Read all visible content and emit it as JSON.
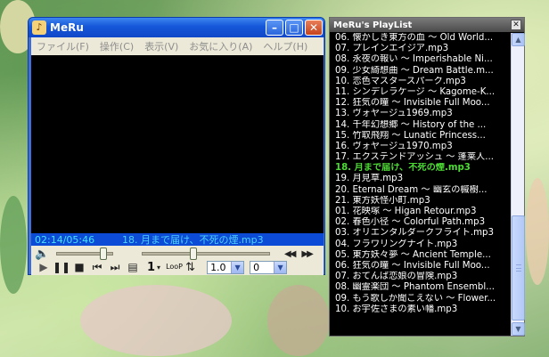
{
  "player": {
    "title": "MeRu",
    "app_icon": "♪",
    "window_buttons": {
      "minimize": "–",
      "maximize": "□",
      "close": "✕"
    },
    "menu": [
      "ファイル(F)",
      "操作(C)",
      "表示(V)",
      "お気に入り(A)",
      "ヘルプ(H)"
    ],
    "status": {
      "time": "02:14/05:46",
      "now_playing": "18. 月まで届け、不死の煙.mp3"
    },
    "controls": {
      "speaker_icon": "🔈",
      "volume_level": 0.85,
      "seek_position": 0.39,
      "prev_glyph": "◀◀",
      "next_glyph": "▶▶",
      "play": "▶",
      "pause": "❚❚",
      "stop": "■",
      "prev_track": "⏮",
      "next_track": "⏭",
      "playlist_icon": "▤",
      "repeat_value": "1",
      "dropdown_glyph": "▾",
      "loop_label": "LooP",
      "shuffle_icon": "⇅",
      "speed_value": "1.0",
      "pitch_value": "0",
      "select_arrow": "▼"
    }
  },
  "playlist": {
    "title": "MeRu's PlayList",
    "close": "✕",
    "items": [
      "06. 懐かしき東方の血 ～ Old World...",
      "07. プレインエイジア.mp3",
      "08. 永夜の報い ～ Imperishable Ni...",
      "09. 少女綺想曲 ～ Dream Battle.m...",
      "10. 恋色マスタースパーク.mp3",
      "11. シンデレラケージ ～ Kagome-K...",
      "12. 狂気の瞳 ～ Invisible Full Moo...",
      "13. ヴォヤージュ1969.mp3",
      "14. 千年幻想郷 ～ History of the ...",
      "15. 竹取飛翔 ～ Lunatic Princess...",
      "16. ヴォヤージュ1970.mp3",
      "17. エクステンドアッシュ ～ 蓬莱人...",
      "18. 月まで届け、不死の煙.mp3",
      "19. 月見草.mp3",
      "20. Eternal Dream ～ 幽玄の槭樹...",
      "21. 東方妖怪小町.mp3",
      "01. 花映塚 ～ Higan Retour.mp3",
      "02. 春色小径 ～ Colorful Path.mp3",
      "03. オリエンタルダークフライト.mp3",
      "04. フラワリングナイト.mp3",
      "05. 東方妖々夢 ～ Ancient Temple...",
      "06. 狂気の瞳 ～ Invisible Full Moo...",
      "07. おてんば恋娘の冒険.mp3",
      "08. 幽霊楽団 ～ Phantom Ensembl...",
      "09. もう歌しか聞こえない ～ Flower...",
      "10. お宇佐さまの素い幡.mp3"
    ],
    "current_index": 12,
    "scrollbar": {
      "up": "▲",
      "down": "▼"
    }
  }
}
